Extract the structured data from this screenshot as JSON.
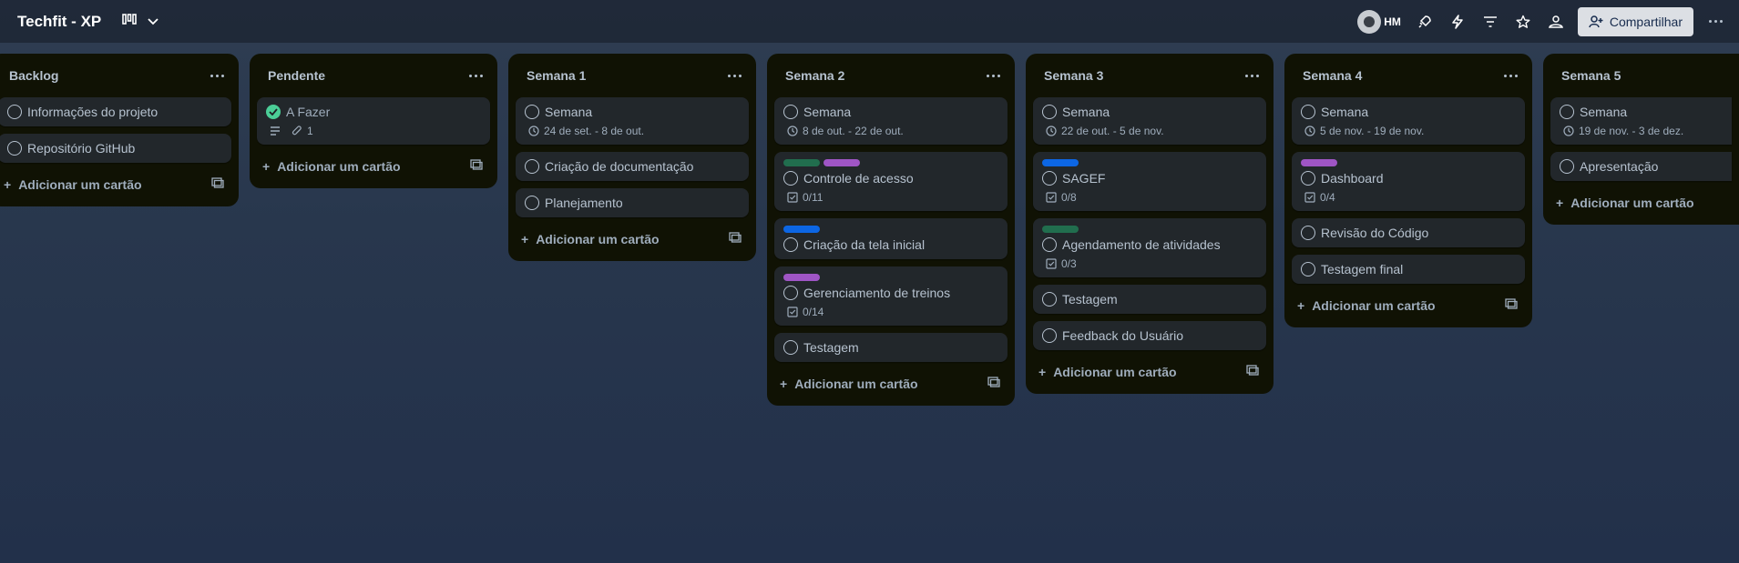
{
  "board": {
    "title": "Techfit - XP"
  },
  "header": {
    "initials": "HM",
    "share_label": "Compartilhar"
  },
  "add_card_label": "Adicionar um cartão",
  "label_colors": {
    "green": "#216e4e",
    "purple": "#9f55c5",
    "blue": "#0c66e4"
  },
  "lists": [
    {
      "title": "Backlog",
      "cards": [
        {
          "title": "Informações do projeto"
        },
        {
          "title": "Repositório GitHub"
        }
      ]
    },
    {
      "title": "Pendente",
      "cards": [
        {
          "title": "A Fazer",
          "attachments": "1"
        }
      ]
    },
    {
      "title": "Semana 1",
      "cards": [
        {
          "title": "Semana",
          "dates": "24 de set. - 8 de out."
        },
        {
          "title": "Criação de documentação"
        },
        {
          "title": "Planejamento"
        }
      ]
    },
    {
      "title": "Semana 2",
      "cards": [
        {
          "title": "Semana",
          "dates": "8 de out. - 22 de out."
        },
        {
          "title": "Controle de acesso",
          "checklist": "0/11"
        },
        {
          "title": "Criação da tela inicial"
        },
        {
          "title": "Gerenciamento de treinos",
          "checklist": "0/14"
        },
        {
          "title": "Testagem"
        }
      ]
    },
    {
      "title": "Semana 3",
      "cards": [
        {
          "title": "Semana",
          "dates": "22 de out. - 5 de nov."
        },
        {
          "title": "SAGEF",
          "checklist": "0/8"
        },
        {
          "title": "Agendamento de atividades",
          "checklist": "0/3"
        },
        {
          "title": "Testagem"
        },
        {
          "title": "Feedback do Usuário"
        }
      ]
    },
    {
      "title": "Semana 4",
      "cards": [
        {
          "title": "Semana",
          "dates": "5 de nov. - 19 de nov."
        },
        {
          "title": "Dashboard",
          "checklist": "0/4"
        },
        {
          "title": "Revisão do Código"
        },
        {
          "title": "Testagem final"
        }
      ]
    },
    {
      "title": "Semana 5",
      "cards": [
        {
          "title": "Semana",
          "dates": "19 de nov. - 3 de dez."
        },
        {
          "title": "Apresentação"
        }
      ]
    }
  ]
}
